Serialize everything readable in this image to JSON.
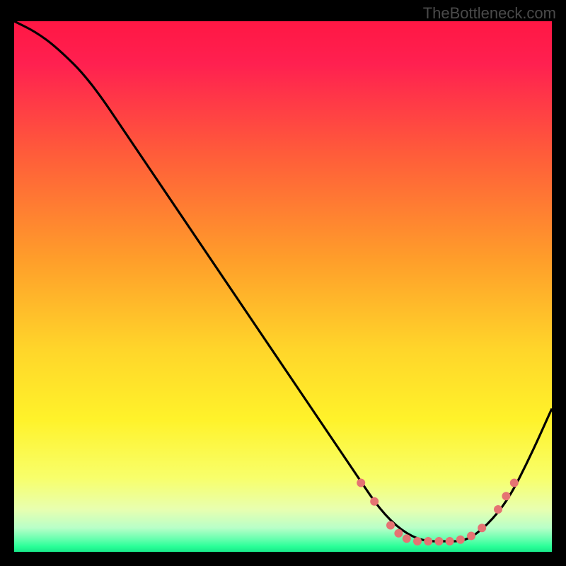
{
  "watermark": "TheBottleneck.com",
  "chart_data": {
    "type": "line",
    "title": "",
    "xlabel": "",
    "ylabel": "",
    "xlim": [
      0,
      100
    ],
    "ylim": [
      0,
      100
    ],
    "gradient_stops": [
      {
        "offset": 0,
        "color": "#ff1744"
      },
      {
        "offset": 0.08,
        "color": "#ff2050"
      },
      {
        "offset": 0.25,
        "color": "#ff5c3a"
      },
      {
        "offset": 0.45,
        "color": "#ff9e2a"
      },
      {
        "offset": 0.62,
        "color": "#ffd62a"
      },
      {
        "offset": 0.75,
        "color": "#fff22a"
      },
      {
        "offset": 0.86,
        "color": "#f8ff6a"
      },
      {
        "offset": 0.92,
        "color": "#e8ffb0"
      },
      {
        "offset": 0.955,
        "color": "#b8ffc8"
      },
      {
        "offset": 0.975,
        "color": "#6affb0"
      },
      {
        "offset": 0.99,
        "color": "#2aff98"
      },
      {
        "offset": 1.0,
        "color": "#18e889"
      }
    ],
    "series": [
      {
        "name": "bottleneck-curve",
        "x": [
          0,
          4,
          8,
          14,
          22,
          30,
          40,
          50,
          58,
          64,
          68,
          72,
          76,
          80,
          84,
          88,
          92,
          96,
          100
        ],
        "y": [
          100,
          98,
          95,
          89,
          77,
          65,
          50,
          35,
          23,
          14,
          8,
          4,
          2,
          2,
          2,
          5,
          10,
          18,
          27
        ]
      }
    ],
    "markers": {
      "series": "bottleneck-curve",
      "color": "#e57373",
      "radius": 6,
      "points": [
        {
          "x": 64.5,
          "y": 13
        },
        {
          "x": 67,
          "y": 9.5
        },
        {
          "x": 70,
          "y": 5
        },
        {
          "x": 71.5,
          "y": 3.5
        },
        {
          "x": 73,
          "y": 2.5
        },
        {
          "x": 75,
          "y": 2
        },
        {
          "x": 77,
          "y": 2
        },
        {
          "x": 79,
          "y": 2
        },
        {
          "x": 81,
          "y": 2
        },
        {
          "x": 83,
          "y": 2.3
        },
        {
          "x": 85,
          "y": 3
        },
        {
          "x": 87,
          "y": 4.5
        },
        {
          "x": 90,
          "y": 8
        },
        {
          "x": 91.5,
          "y": 10.5
        },
        {
          "x": 93,
          "y": 13
        }
      ]
    }
  }
}
